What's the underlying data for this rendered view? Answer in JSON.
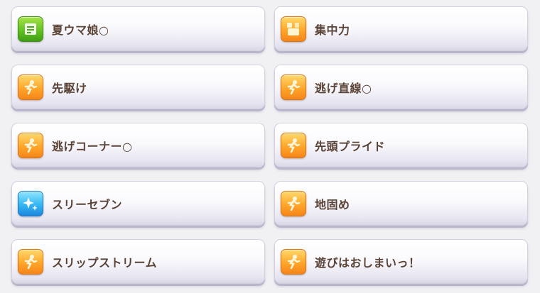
{
  "skills": [
    {
      "label": "夏ウマ娘○",
      "icon": "green-skill-icon",
      "color": "#6ac81f"
    },
    {
      "label": "集中力",
      "icon": "orange-skill-icon",
      "color": "#ffa62a"
    },
    {
      "label": "先駆け",
      "icon": "running-figure-icon",
      "color": "#ffa62a"
    },
    {
      "label": "逃げ直線○",
      "icon": "running-figure-icon",
      "color": "#ffa62a"
    },
    {
      "label": "逃げコーナー○",
      "icon": "running-figure-icon",
      "color": "#ffa62a"
    },
    {
      "label": "先頭プライド",
      "icon": "running-figure-icon",
      "color": "#ffa62a"
    },
    {
      "label": "スリーセブン",
      "icon": "sparkle-icon",
      "color": "#35b6f2"
    },
    {
      "label": "地固め",
      "icon": "running-figure-icon",
      "color": "#ffa62a"
    },
    {
      "label": "スリップストリーム",
      "icon": "running-figure-icon",
      "color": "#ffa62a"
    },
    {
      "label": "遊びはおしまいっ！",
      "icon": "running-figure-icon",
      "color": "#ffa62a"
    }
  ]
}
